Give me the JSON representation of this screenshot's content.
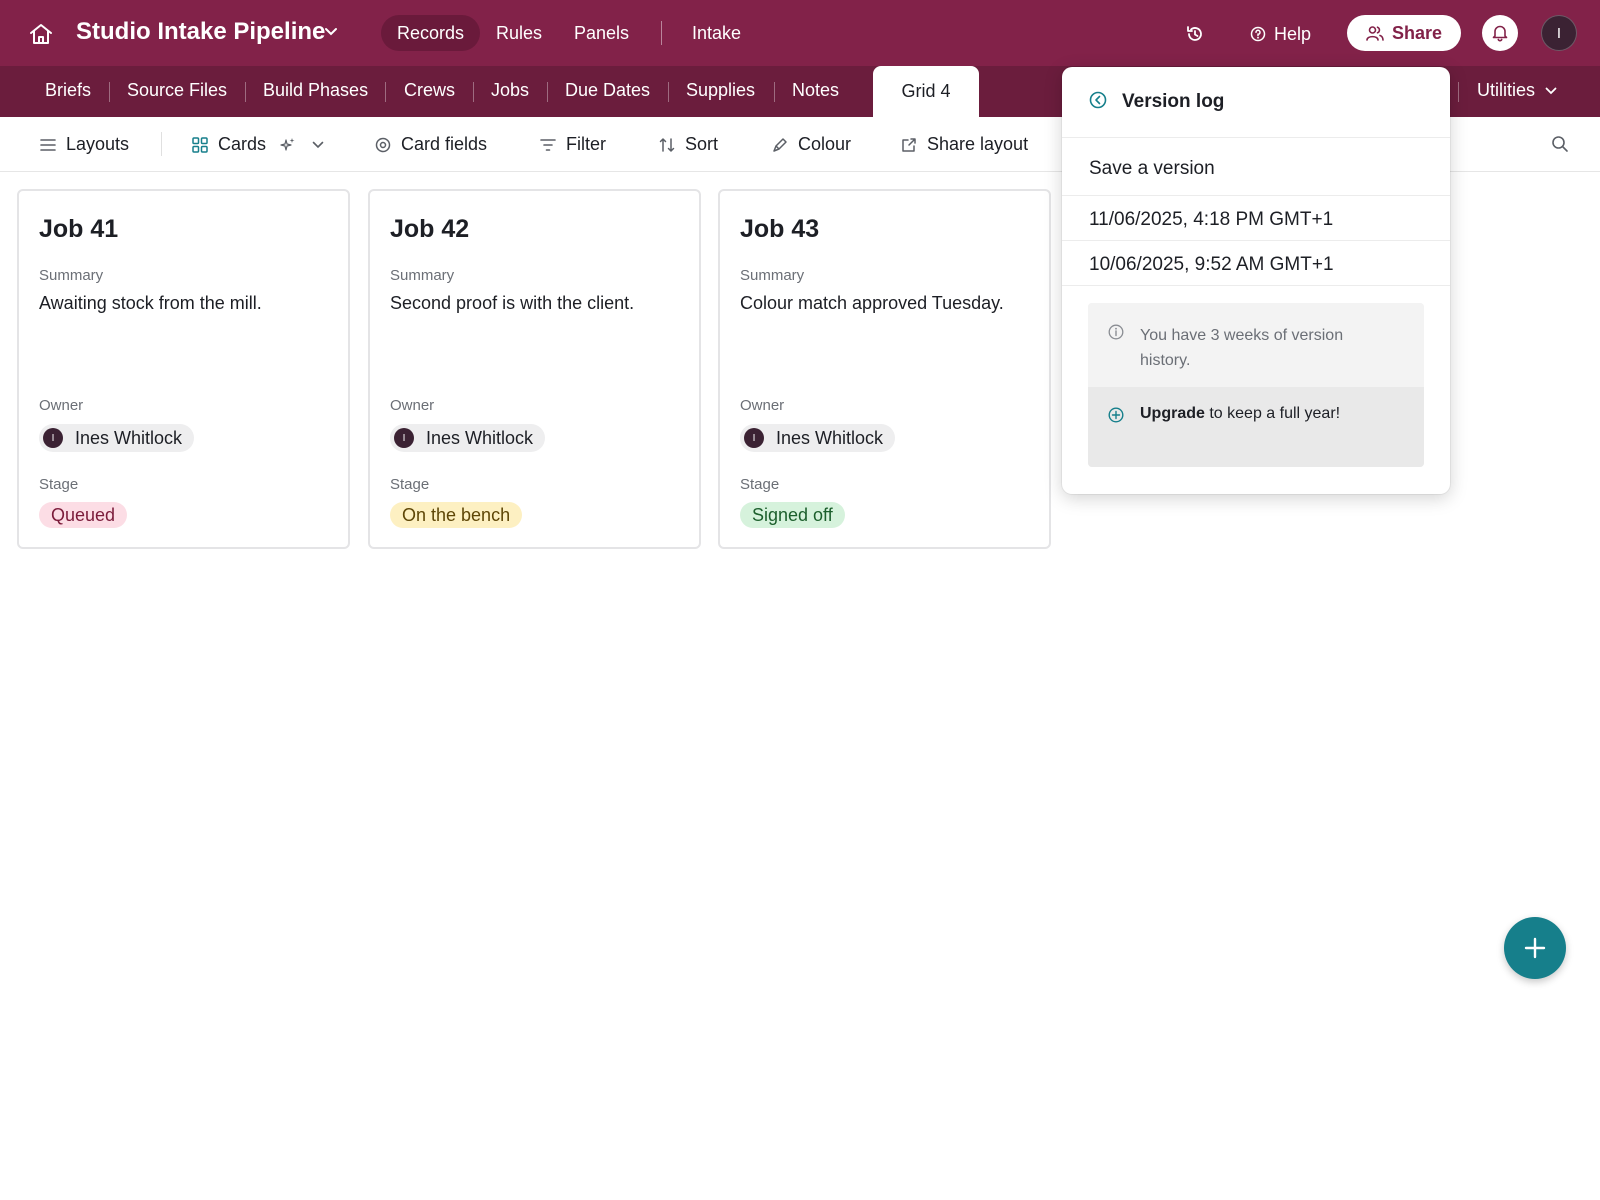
{
  "app": {
    "base_title": "Studio Intake Pipeline",
    "nav": [
      {
        "label": "Records",
        "active": true
      },
      {
        "label": "Rules",
        "active": false
      },
      {
        "label": "Panels",
        "active": false
      },
      {
        "label": "Intake",
        "active": false
      }
    ],
    "help_label": "Help",
    "share_label": "Share",
    "user_initial": "I",
    "colors": {
      "brand": "#822249",
      "tabbar": "#6b1d3d",
      "accent": "#167f8b"
    }
  },
  "tables": {
    "items": [
      "Briefs",
      "Source Files",
      "Build Phases",
      "Crews",
      "Jobs",
      "Due Dates",
      "Supplies",
      "Notes"
    ],
    "active": "Grid 4",
    "utilities_label": "Utilities"
  },
  "toolbar": {
    "layouts": "Layouts",
    "view_name": "Cards",
    "card_fields": "Card fields",
    "filter": "Filter",
    "sort": "Sort",
    "colour": "Colour",
    "share_layout": "Share layout"
  },
  "cards": [
    {
      "title": "Job 41",
      "summary_label": "Summary",
      "summary": "Awaiting stock from the mill.",
      "owner_label": "Owner",
      "owner": "Ines Whitlock",
      "owner_initial": "I",
      "stage_label": "Stage",
      "stage": "Queued",
      "stage_bg": "#fcdde5",
      "stage_fg": "#7b1b3a"
    },
    {
      "title": "Job 42",
      "summary_label": "Summary",
      "summary": "Second proof is with the client.",
      "owner_label": "Owner",
      "owner": "Ines Whitlock",
      "owner_initial": "I",
      "stage_label": "Stage",
      "stage": "On the bench",
      "stage_bg": "#fdf0c2",
      "stage_fg": "#5e4606"
    },
    {
      "title": "Job 43",
      "summary_label": "Summary",
      "summary": "Colour match approved Tuesday.",
      "owner_label": "Owner",
      "owner": "Ines Whitlock",
      "owner_initial": "I",
      "stage_label": "Stage",
      "stage": "Signed off",
      "stage_bg": "#d6f2dc",
      "stage_fg": "#1c5f2c"
    }
  ],
  "version_log": {
    "title": "Version log",
    "save_label": "Save a version",
    "versions": [
      "11/06/2025, 4:18 PM GMT+1",
      "10/06/2025, 9:52 AM GMT+1"
    ],
    "notice": "You have 3 weeks of version history.",
    "upgrade_strong": "Upgrade",
    "upgrade_rest": " to keep a full year!"
  }
}
